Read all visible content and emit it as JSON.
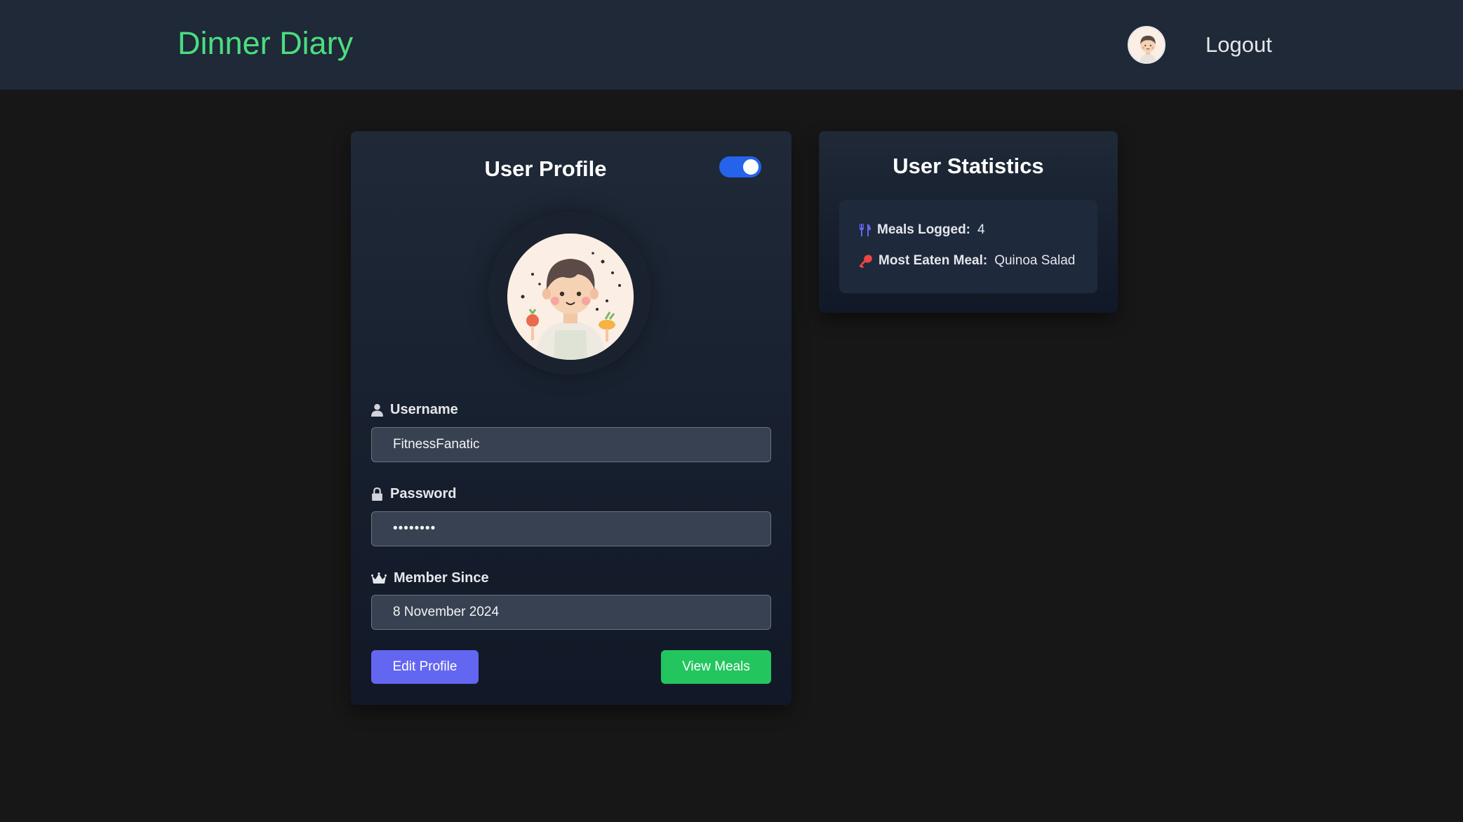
{
  "app": {
    "brand": "Dinner Diary",
    "logout_label": "Logout"
  },
  "profile": {
    "title": "User Profile",
    "toggle_on": true,
    "fields": {
      "username": {
        "label": "Username",
        "value": "FitnessFanatic"
      },
      "password": {
        "label": "Password",
        "value": "••••••••"
      },
      "member_since": {
        "label": "Member Since",
        "value": "8 November 2024"
      }
    },
    "buttons": {
      "edit": "Edit Profile",
      "view_meals": "View Meals"
    }
  },
  "stats": {
    "title": "User Statistics",
    "meals_logged": {
      "label": "Meals Logged:",
      "value": "4"
    },
    "most_eaten": {
      "label": "Most Eaten Meal:",
      "value": "Quinoa Salad"
    }
  },
  "colors": {
    "brand": "#4ade80",
    "toggle": "#2563eb",
    "edit_button": "#6366f1",
    "view_button": "#22c55e",
    "utensils_icon": "#6366f1",
    "drumstick_icon": "#ef4444"
  },
  "icons": [
    "user-icon",
    "lock-icon",
    "crown-icon",
    "utensils-icon",
    "drumstick-icon",
    "avatar-chef"
  ]
}
